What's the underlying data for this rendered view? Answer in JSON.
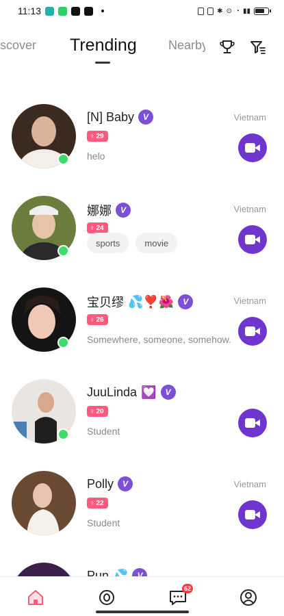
{
  "status_bar": {
    "time": "11:13",
    "app_colors": [
      "#20b2aa",
      "#25d366",
      "#111111",
      "#111111"
    ]
  },
  "top_nav": {
    "tabs": [
      {
        "label": "scover",
        "active": false
      },
      {
        "label": "Trending",
        "active": true
      },
      {
        "label": "Nearby",
        "active": false
      }
    ],
    "icons": [
      "trophy-icon",
      "filter-icon"
    ]
  },
  "colors": {
    "accent": "#6e36cf",
    "verified": "#7b4fd6",
    "age_badge": "#ff5a7e",
    "online": "#3ddc6c",
    "notification": "#ff3b3b"
  },
  "users": [
    {
      "name": "[N] Baby",
      "emoji": "",
      "verified": true,
      "age": "29",
      "country": "Vietnam",
      "bio": "helo",
      "tags": [],
      "online": true,
      "avatar_colors": [
        "#3a2a1f",
        "#d9b49a",
        "#f3efe8"
      ]
    },
    {
      "name": "娜娜",
      "emoji": "",
      "verified": true,
      "age": "24",
      "country": "Vietnam",
      "bio": "",
      "tags": [
        "sports",
        "movie"
      ],
      "online": true,
      "avatar_colors": [
        "#6b7d3c",
        "#e6c4a7",
        "#2a2a2a"
      ]
    },
    {
      "name": "宝贝缪",
      "emoji": "💦❣️🌺",
      "verified": true,
      "age": "26",
      "country": "Vietnam",
      "bio": "Somewhere, someone, somehow.",
      "tags": [],
      "online": true,
      "avatar_colors": [
        "#141414",
        "#f0c9b6",
        "#2a1c18"
      ]
    },
    {
      "name": "JuuLinda",
      "emoji": "💟",
      "verified": true,
      "age": "20",
      "country": "",
      "bio": "Student",
      "tags": [],
      "online": true,
      "avatar_colors": [
        "#e9e6e2",
        "#d6a98c",
        "#1f1f1f"
      ]
    },
    {
      "name": "Polly",
      "emoji": "",
      "verified": true,
      "age": "22",
      "country": "Vietnam",
      "bio": "Student",
      "tags": [],
      "online": false,
      "avatar_colors": [
        "#6b4a33",
        "#e8c6ad",
        "#f4f0ea"
      ]
    },
    {
      "name": "Pun",
      "emoji": "💦",
      "verified": true,
      "age": "",
      "country": "",
      "bio": "",
      "tags": [],
      "online": false,
      "avatar_colors": [
        "#3a1f4a",
        "#3a1f4a",
        "#3a1f4a"
      ]
    }
  ],
  "bottom_nav": {
    "items": [
      {
        "icon": "home-icon",
        "active": true
      },
      {
        "icon": "watch-icon",
        "active": false
      },
      {
        "icon": "chat-icon",
        "active": false
      },
      {
        "icon": "profile-icon",
        "active": false
      }
    ],
    "chat_badge": "62"
  }
}
